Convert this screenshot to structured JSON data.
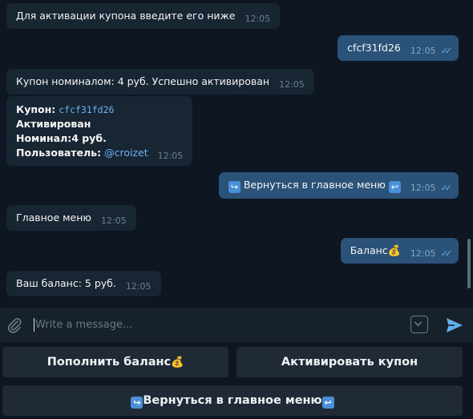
{
  "messages": [
    {
      "text": "Для активации купона введите его ниже",
      "time": "12:05"
    },
    {
      "text": "cfcf31fd26",
      "time": "12:05"
    },
    {
      "text": "Купон номиналом: 4 руб. Успешно активирован",
      "time": "12:05"
    },
    {
      "coupon_label": "Купон:",
      "coupon_code": "cfcf31fd26",
      "status": "Активирован",
      "nominal": "Номинал:4 руб.",
      "user_label": "Пользователь:",
      "user": "@croizet",
      "time": "12:05"
    },
    {
      "text": "Вернуться в главное меню",
      "time": "12:05"
    },
    {
      "text": "Главное меню",
      "time": "12:05"
    },
    {
      "text": "Баланс",
      "time": "12:05"
    },
    {
      "text": "Ваш баланс: 5 руб.",
      "time": "12:05"
    }
  ],
  "composer": {
    "placeholder": "Write a message..."
  },
  "keyboard": {
    "topup": "Пополнить баланс",
    "activate": "Активировать купон",
    "back": "Вернуться в главное меню"
  },
  "icons": {
    "attach": "paperclip-icon",
    "keyboard": "chevron-down-icon",
    "send": "send-icon",
    "moneybag": "💰",
    "left_arrow": "↩",
    "right_arrow": "↪"
  },
  "colors": {
    "background": "#0e1621",
    "incoming": "#182533",
    "outgoing": "#2b5278",
    "accent": "#5fb0ee",
    "button": "#1f2a36"
  }
}
